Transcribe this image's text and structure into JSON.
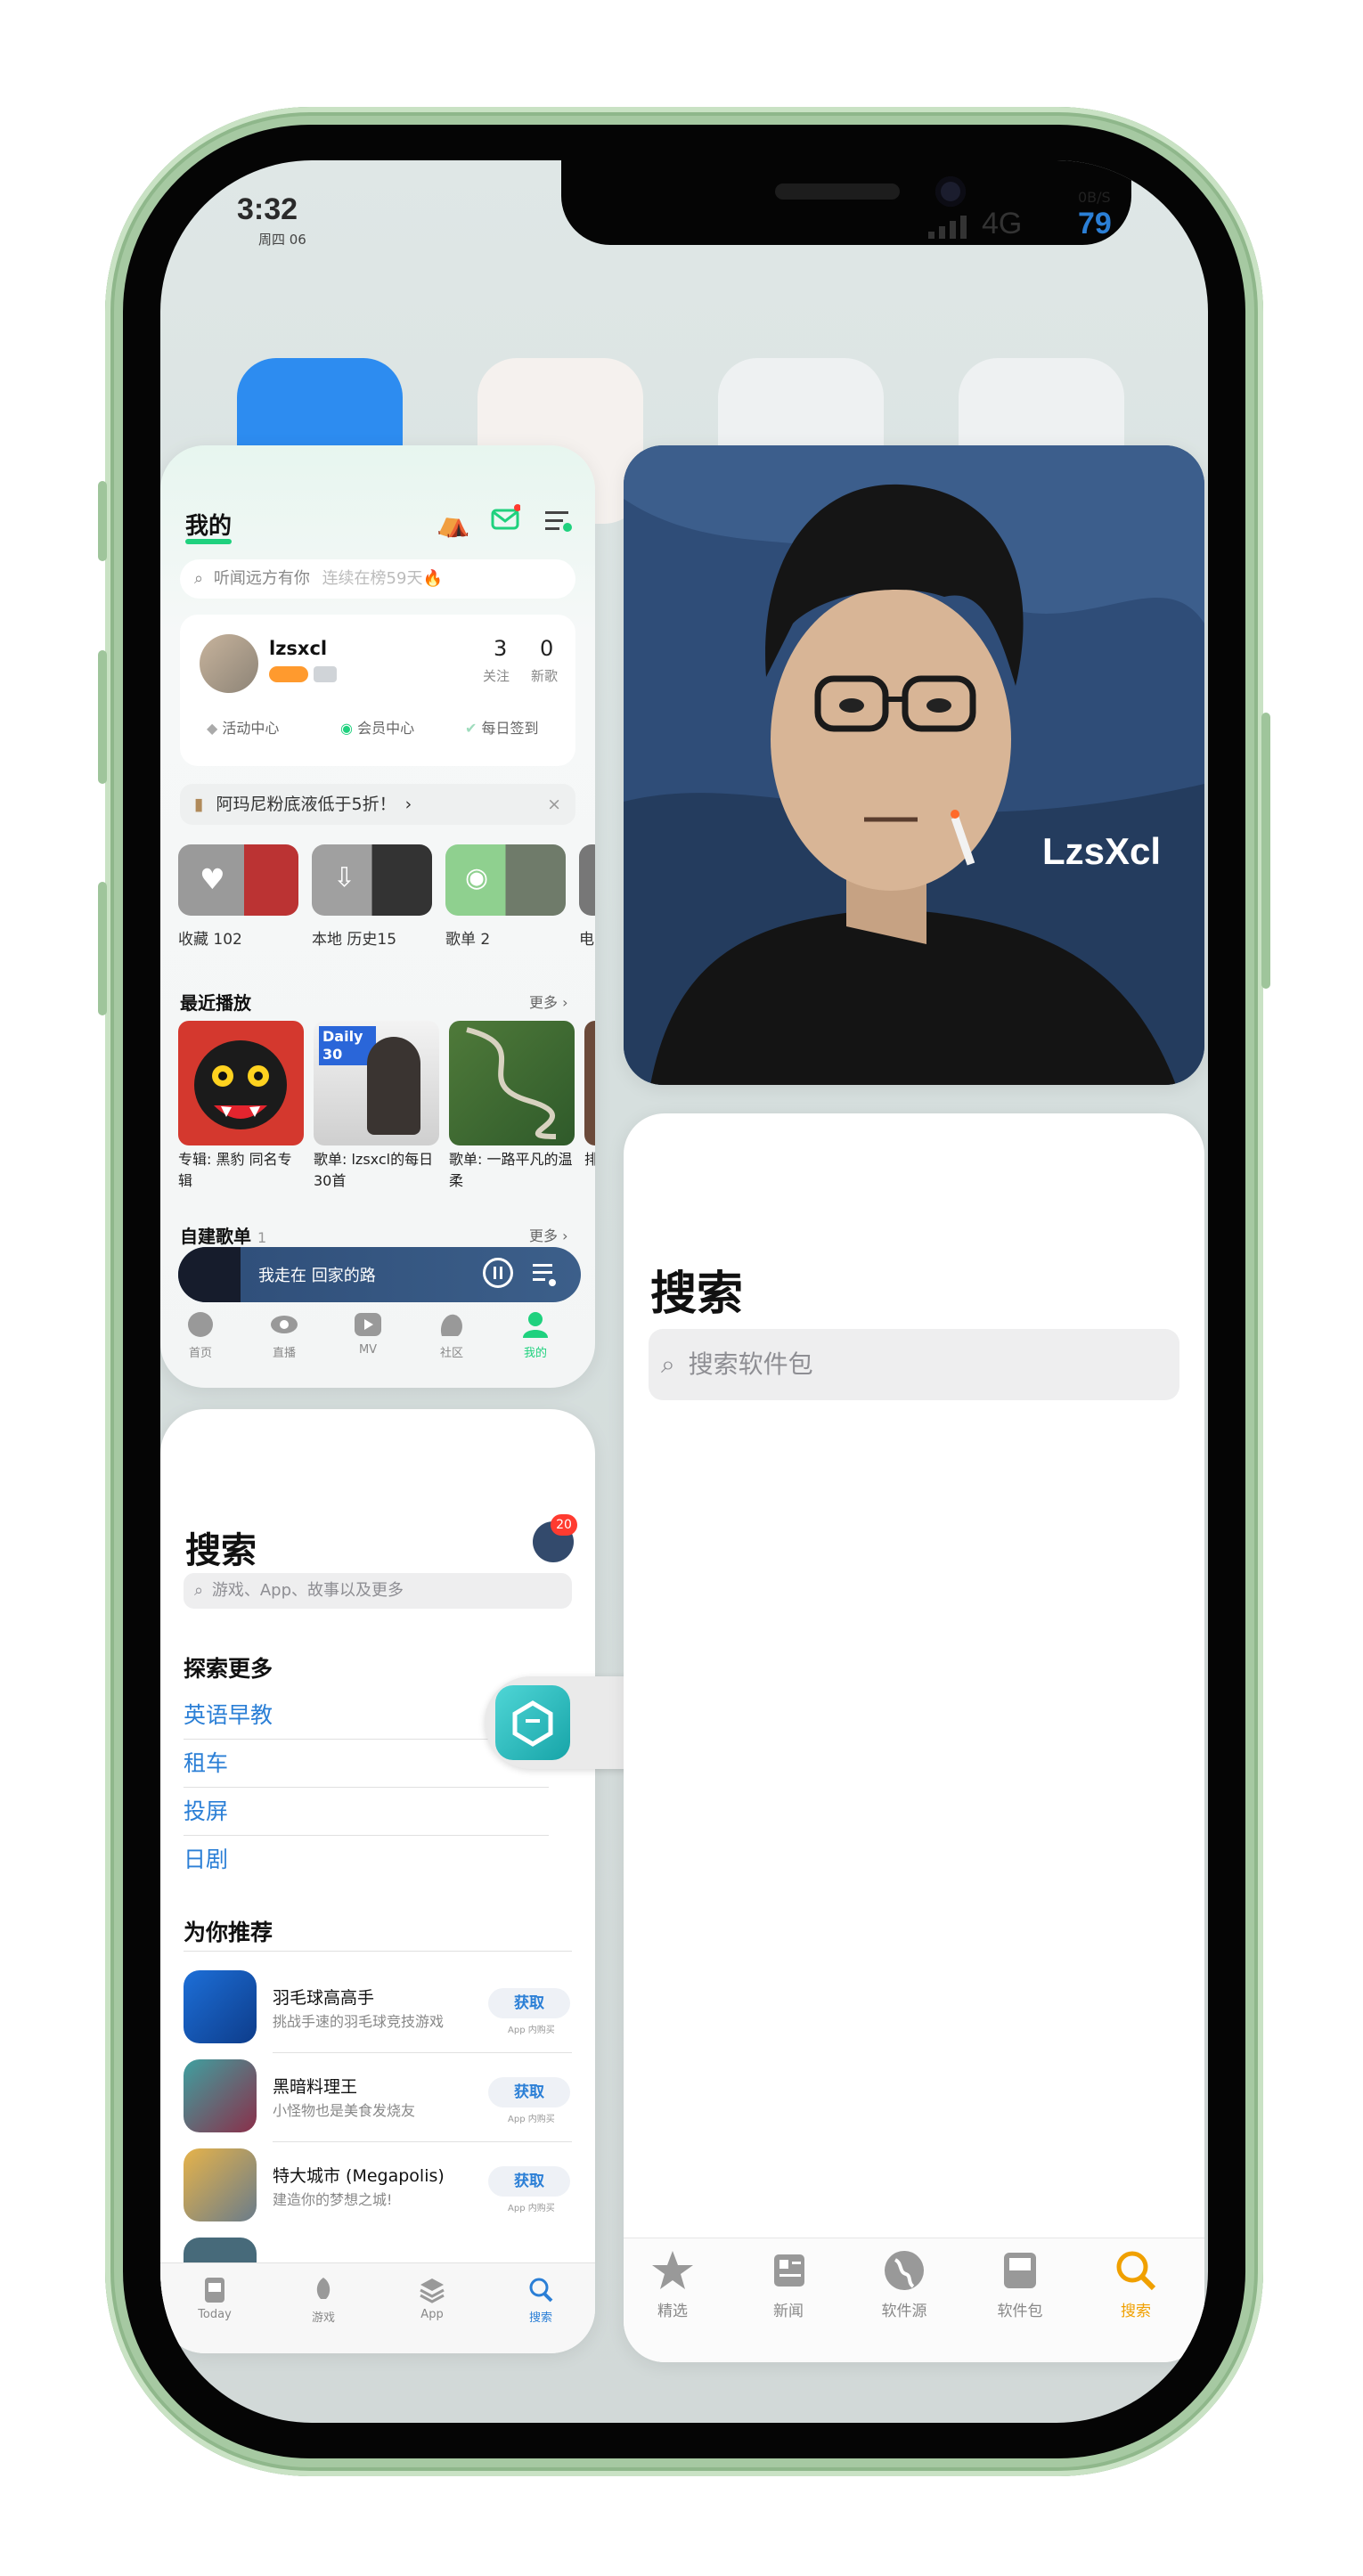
{
  "status_bar": {
    "time": "3:32",
    "date": "周四 06",
    "net_speed": "0B/S",
    "network": "4G",
    "battery": "79"
  },
  "music_app": {
    "tab_title": "我的",
    "search_placeholder": "听闻远方有你",
    "search_hint": "连续在榜59天🔥",
    "user": {
      "name": "lzsxcl",
      "follow_count": "3",
      "follow_label": "关注",
      "new_count": "0",
      "new_label": "新歌"
    },
    "quick_links": [
      "活动中心",
      "会员中心",
      "每日签到"
    ],
    "banner_text": "阿玛尼粉底液低于5折！",
    "tiles": [
      "收藏 102",
      "本地 历史15",
      "歌单 2",
      "电"
    ],
    "recent_title": "最近播放",
    "more_label": "更多",
    "recent_items": [
      "专辑: 黑豹 同名专辑",
      "歌单: lzsxcl的每日30首",
      "歌单: 一路平凡的温柔",
      "排"
    ],
    "daily_badge": "Daily 30",
    "custom_playlist_title": "自建歌单",
    "custom_playlist_count": "1",
    "now_playing": "我走在 回家的路",
    "tabs": [
      "首页",
      "直播",
      "MV",
      "社区",
      "我的"
    ]
  },
  "app_store": {
    "title": "搜索",
    "badge_count": "20",
    "search_placeholder": "游戏、App、故事以及更多",
    "discover_title": "探索更多",
    "discover_links": [
      "英语早教",
      "租车",
      "投屏",
      "日剧"
    ],
    "recommend_title": "为你推荐",
    "apps": [
      {
        "name": "羽毛球高高手",
        "subtitle": "挑战手速的羽毛球竞技游戏",
        "button": "获取",
        "note": "App 内购买"
      },
      {
        "name": "黑暗料理王",
        "subtitle": "小怪物也是美食发烧友",
        "button": "获取",
        "note": "App 内购买"
      },
      {
        "name": "特大城市 (Megapolis)",
        "subtitle": "建造你的梦想之城!",
        "button": "获取",
        "note": "App 内购买"
      }
    ],
    "tabs": [
      "Today",
      "游戏",
      "App",
      "搜索"
    ]
  },
  "avatar_card": {
    "signature": "LzsXcl"
  },
  "sileo": {
    "title": "搜索",
    "search_placeholder": "搜索软件包",
    "tabs": [
      "精选",
      "新闻",
      "软件源",
      "软件包",
      "搜索"
    ]
  },
  "colors": {
    "accent_green": "#1fd17e",
    "ios_blue": "#2b7fd6",
    "sileo_active": "#f0a000",
    "phone_green": "#a6c9a2"
  }
}
